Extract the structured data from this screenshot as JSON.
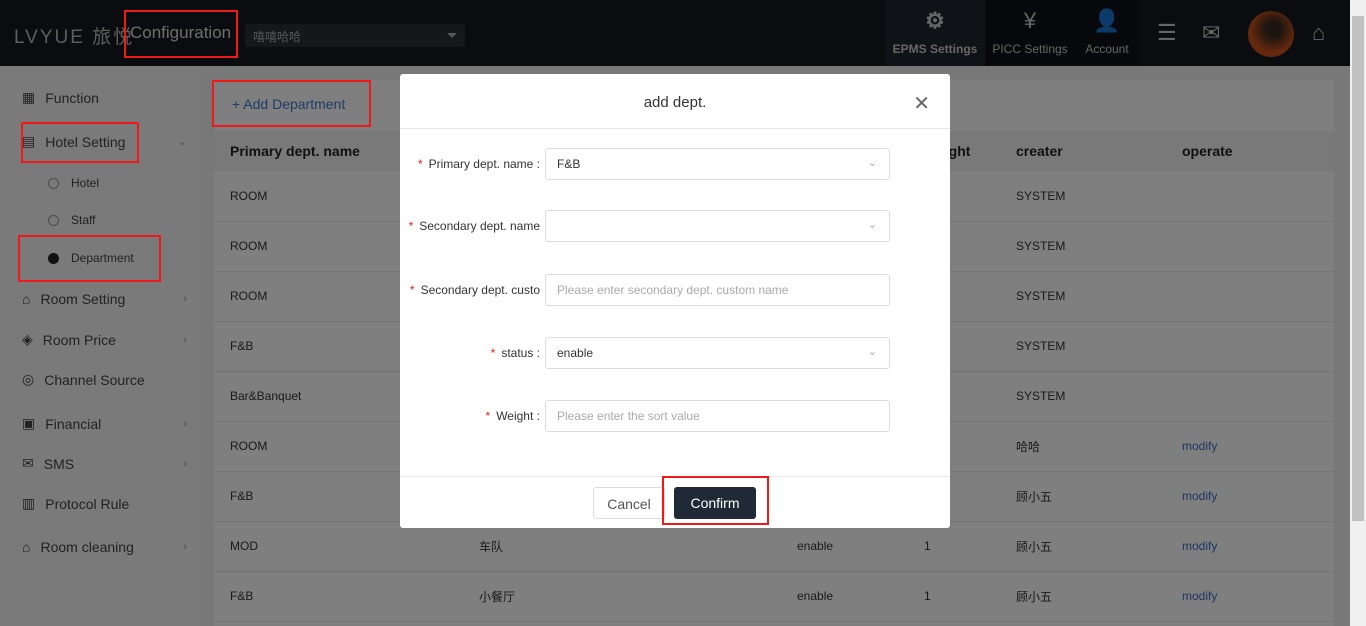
{
  "header": {
    "logo": "LVYUE 旅悦",
    "title": "Configuration",
    "hotel_select": "嘻嘻哈哈",
    "nav": [
      {
        "label": "EPMS Settings",
        "icon": "gear-icon"
      },
      {
        "label": "PICC Settings",
        "icon": "clipboard-yen-icon"
      },
      {
        "label": "Account",
        "icon": "user-gear-icon"
      }
    ]
  },
  "sidebar": {
    "items": [
      {
        "label": "Function"
      },
      {
        "label": "Hotel Setting"
      },
      {
        "label": "Room Setting"
      },
      {
        "label": "Room Price"
      },
      {
        "label": "Channel Source"
      },
      {
        "label": "Financial"
      },
      {
        "label": "SMS"
      },
      {
        "label": "Protocol Rule"
      },
      {
        "label": "Room cleaning"
      }
    ],
    "sub": [
      {
        "label": "Hotel"
      },
      {
        "label": "Staff"
      },
      {
        "label": "Department"
      }
    ]
  },
  "main": {
    "add_label": "+ Add Department",
    "columns": [
      "Primary dept. name",
      "",
      "",
      "Weight",
      "creater",
      "operate"
    ],
    "rows": [
      [
        "ROOM",
        "",
        "",
        "",
        "SYSTEM",
        ""
      ],
      [
        "ROOM",
        "",
        "",
        "",
        "SYSTEM",
        ""
      ],
      [
        "ROOM",
        "",
        "",
        "",
        "SYSTEM",
        ""
      ],
      [
        "F&B",
        "",
        "",
        "",
        "SYSTEM",
        ""
      ],
      [
        "Bar&Banquet",
        "",
        "",
        "",
        "SYSTEM",
        ""
      ],
      [
        "ROOM",
        "",
        "",
        "",
        "哈哈",
        "modify"
      ],
      [
        "F&B",
        "",
        "",
        "",
        "顾小五",
        "modify"
      ],
      [
        "MOD",
        "车队",
        "enable",
        "1",
        "顾小五",
        "modify"
      ],
      [
        "F&B",
        "小餐厅",
        "enable",
        "1",
        "顾小五",
        "modify"
      ]
    ]
  },
  "modal": {
    "title": "add dept.",
    "fields": [
      {
        "label": "Primary dept. name :",
        "value": "F&B",
        "placeholder": ""
      },
      {
        "label": "Secondary dept. name",
        "value": "",
        "placeholder": ""
      },
      {
        "label": "Secondary dept. custo",
        "value": "",
        "placeholder": "Please enter secondary dept. custom name"
      },
      {
        "label": "status :",
        "value": "enable",
        "placeholder": ""
      },
      {
        "label": "Weight :",
        "value": "",
        "placeholder": "Please enter the sort value"
      }
    ],
    "cancel": "Cancel",
    "confirm": "Confirm"
  }
}
